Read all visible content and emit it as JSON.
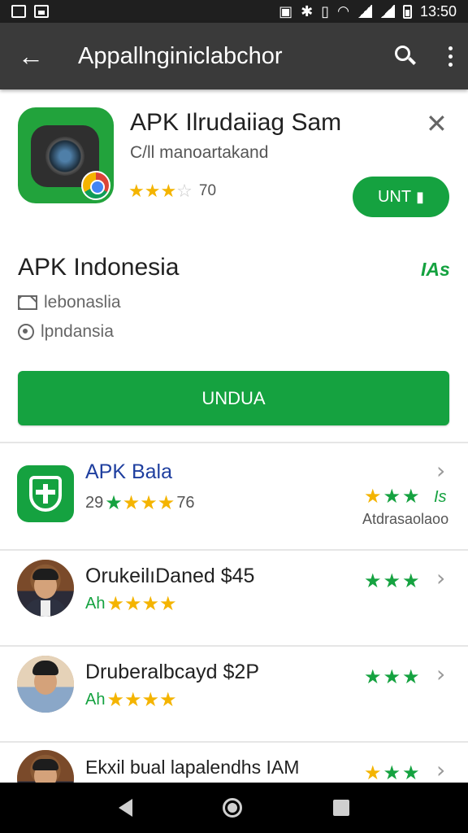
{
  "status_bar": {
    "time": "13:50"
  },
  "toolbar": {
    "back_icon": "arrow-back-icon",
    "title": "Appallnginiclabchor"
  },
  "featured_app": {
    "title": "APK Ilrudaiiag Sam",
    "subtitle": "C/ll manoartakand",
    "rating_stars": 3.5,
    "rating_count": "70",
    "install_label": "UNT"
  },
  "developer": {
    "name": "APK Indonesia",
    "tag": "IAs",
    "email": "lebonaslia",
    "location": "lpndansia",
    "primary_button": "UNDUA"
  },
  "list": [
    {
      "title": "APK Bala",
      "meta_prefix": "29",
      "meta_suffix": "76",
      "side_label": "Is",
      "side_sub": "Atdrasaolaoo"
    },
    {
      "title": "OrukeilıDaned $45",
      "meta_prefix": "Ah"
    },
    {
      "title": "Druberalbcayd $2P",
      "meta_prefix": "Ah"
    },
    {
      "title": "Ekxil bual lapalendhs IAM"
    }
  ],
  "colors": {
    "toolbar": "#3a3a3a",
    "accent_green": "#15a240",
    "star": "#f4b400",
    "title_blue": "#1f3f9f"
  }
}
